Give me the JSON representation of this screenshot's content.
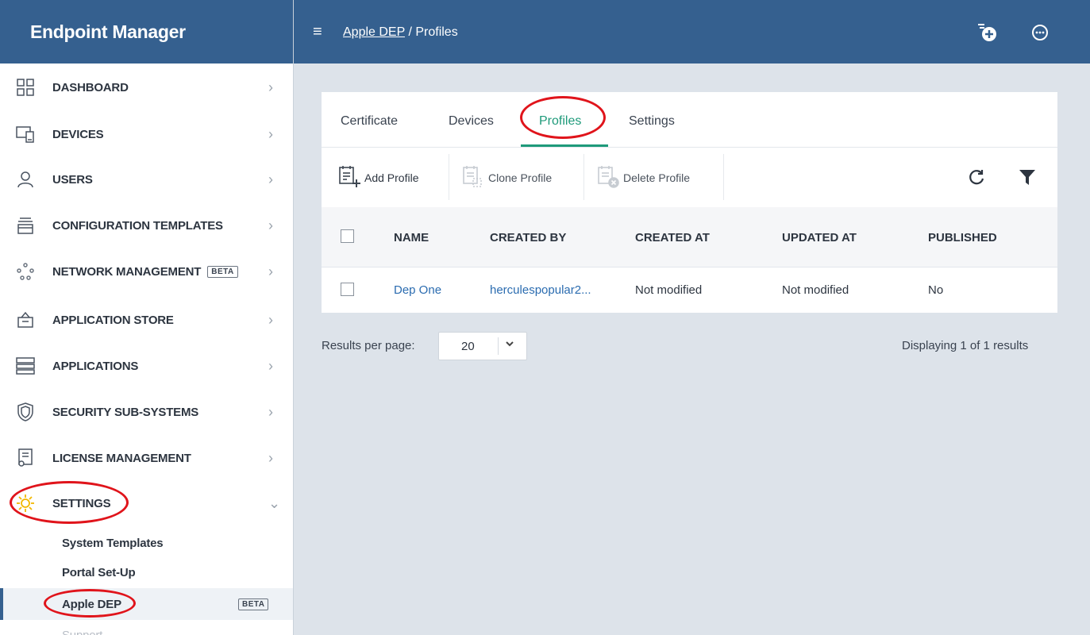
{
  "app": {
    "title": "Endpoint Manager"
  },
  "header": {
    "breadcrumb_link": "Apple DEP",
    "breadcrumb_sep": "/",
    "breadcrumb_current": "Profiles",
    "icons": [
      "hamburger-menu-icon",
      "add-task-icon",
      "more-options-icon"
    ]
  },
  "sidebar": {
    "items": [
      {
        "label": "DASHBOARD",
        "icon": "dashboard-grid-icon"
      },
      {
        "label": "DEVICES",
        "icon": "devices-icon"
      },
      {
        "label": "USERS",
        "icon": "user-icon"
      },
      {
        "label": "CONFIGURATION TEMPLATES",
        "icon": "templates-icon"
      },
      {
        "label": "NETWORK MANAGEMENT",
        "icon": "network-icon",
        "badge": "BETA"
      },
      {
        "label": "APPLICATION STORE",
        "icon": "store-basket-icon"
      },
      {
        "label": "APPLICATIONS",
        "icon": "applications-icon"
      },
      {
        "label": "SECURITY SUB-SYSTEMS",
        "icon": "shield-icon"
      },
      {
        "label": "LICENSE MANAGEMENT",
        "icon": "license-icon"
      },
      {
        "label": "SETTINGS",
        "icon": "settings-gear-icon"
      }
    ],
    "sub_items": [
      {
        "label": "System Templates"
      },
      {
        "label": "Portal Set-Up"
      },
      {
        "label": "Apple DEP",
        "badge": "BETA"
      },
      {
        "label": "Support"
      }
    ]
  },
  "tabs": [
    "Certificate",
    "Devices",
    "Profiles",
    "Settings"
  ],
  "active_tab": "Profiles",
  "toolbar": {
    "add": "Add Profile",
    "clone": "Clone Profile",
    "delete": "Delete Profile"
  },
  "table": {
    "columns": [
      "NAME",
      "CREATED BY",
      "CREATED AT",
      "UPDATED AT",
      "PUBLISHED"
    ],
    "rows": [
      [
        "Dep One",
        "herculespopular2...",
        "Not modified",
        "Not modified",
        "No"
      ]
    ]
  },
  "pager": {
    "label": "Results per page:",
    "value": "20",
    "summary": "Displaying 1 of 1 results"
  },
  "colors": {
    "header_blue": "#35608f",
    "tab_active": "#1e9a7a",
    "link": "#2b6cb0",
    "highlight_ring": "#e0141b",
    "settings_icon": "#f2b700"
  }
}
